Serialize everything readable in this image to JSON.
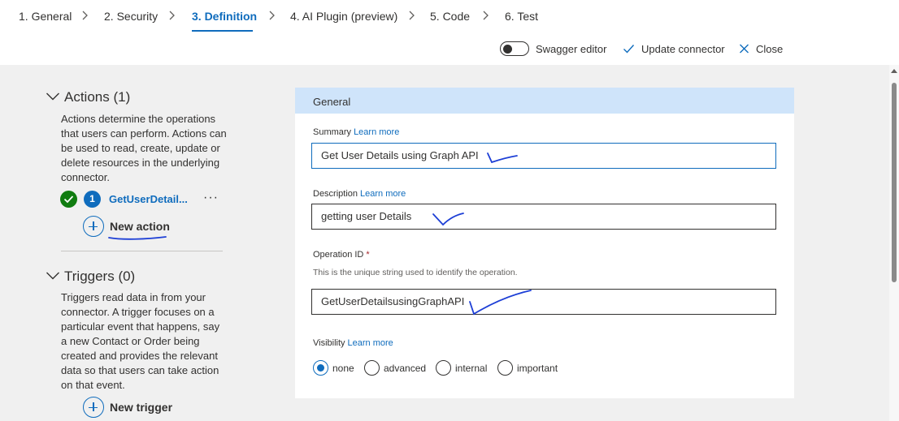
{
  "steps": [
    {
      "label": "1. General"
    },
    {
      "label": "2. Security"
    },
    {
      "label": "3. Definition"
    },
    {
      "label": "4. AI Plugin (preview)"
    },
    {
      "label": "5. Code"
    },
    {
      "label": "6. Test"
    }
  ],
  "active_step": "3. Definition",
  "toolbar": {
    "swagger_label": "Swagger editor",
    "swagger_on": false,
    "update_label": "Update connector",
    "close_label": "Close"
  },
  "actions": {
    "heading": "Actions (1)",
    "description": "Actions determine the operations that users can perform. Actions can be used to read, create, update or delete resources in the underlying connector.",
    "items": [
      {
        "number": "1",
        "name": "GetUserDetail...",
        "more": "···"
      }
    ],
    "new_label": "New action"
  },
  "triggers": {
    "heading": "Triggers (0)",
    "description": "Triggers read data in from your connector. A trigger focuses on a particular event that happens, say a new Contact or Order being created and provides the relevant data so that users can take action on that event.",
    "new_label": "New trigger"
  },
  "general": {
    "title": "General",
    "summary": {
      "label": "Summary",
      "learn_more": "Learn more",
      "value": "Get User Details using Graph API"
    },
    "description": {
      "label": "Description",
      "learn_more": "Learn more",
      "value": "getting user Details"
    },
    "operation_id": {
      "label": "Operation ID",
      "required": "*",
      "hint": "This is the unique string used to identify the operation.",
      "value": "GetUserDetailsusingGraphAPI"
    },
    "visibility": {
      "label": "Visibility",
      "learn_more": "Learn more",
      "options": [
        "none",
        "advanced",
        "internal",
        "important"
      ],
      "selected": "none"
    }
  },
  "colors": {
    "accent": "#0f6cbd",
    "success": "#107c10",
    "card_header": "#cfe4fa",
    "background": "#f0f0f0"
  },
  "icons": [
    "chevron-right-icon",
    "toggle-switch",
    "checkmark-icon",
    "close-icon",
    "chevron-down-icon",
    "success-check-icon",
    "plus-circle-icon"
  ]
}
